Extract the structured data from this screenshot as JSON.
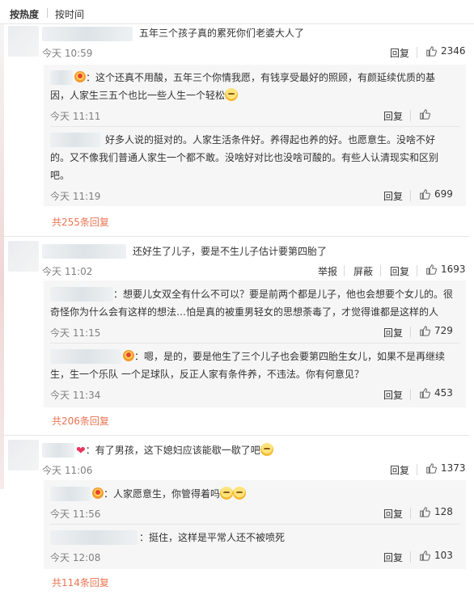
{
  "tabs": {
    "hot": "按热度",
    "time": "按时间"
  },
  "comments": [
    {
      "text": "五年三个孩子真的累死你们老婆大人了",
      "time": "今天 10:59",
      "reply": "回复",
      "likes": "2346",
      "replies": [
        {
          "text_line1": "：这个还真不用酸，五年三个你情我愿，有钱享受最好的照顾，有颜延续优质的基",
          "text_line2": "因，人家生三五个也比一些人生一个轻松",
          "time": "今天 11:11",
          "reply": "回复"
        },
        {
          "text_line1": "好多人说的挺对的。人家生活条件好。养得起也养的好。也愿意生。没啥不好",
          "text_line2": "的。又不像我们普通人家生一个都不敢。没啥好对比也没啥可酸的。有些人认清现实和区别",
          "text_line3": "吧。",
          "time": "今天 11:19",
          "reply": "回复",
          "likes": "699"
        }
      ],
      "more": "共255条回复"
    },
    {
      "text": "还好生了儿子，要是不生儿子估计要第四胎了",
      "time": "今天 11:02",
      "report": "举报",
      "block": "屏蔽",
      "reply": "回复",
      "likes": "1693",
      "replies": [
        {
          "text_line1": "：想要儿女双全有什么不可以？要是前两个都是儿子，他也会想要个女儿的。很",
          "text_line2": "奇怪你为什么会有这样的想法…怕是真的被重男轻女的思想荼毒了，才觉得谁都是这样的人",
          "time": "今天 11:15",
          "reply": "回复",
          "likes": "729"
        },
        {
          "text_line1": "：嗯，是的，要是他生了三个儿子也会要第四胎生女儿，如果不是再继续",
          "text_line2": "生，生一个乐队 一个足球队，反正人家有条件养，不违法。你有何意见？",
          "time": "今天 11:34",
          "reply": "回复",
          "likes": "453"
        }
      ],
      "more": "共206条回复"
    },
    {
      "text": "：有了男孩，这下媳妇应该能歇一歇了吧",
      "time": "今天 11:06",
      "reply": "回复",
      "likes": "1373",
      "replies": [
        {
          "text_line1": "：人家愿意生，你管得着吗",
          "time": "今天 11:56",
          "reply": "回复",
          "likes": "128"
        },
        {
          "text_line1": "：挺住，这样是平常人还不被喷死",
          "time": "今天 12:08",
          "reply": "回复",
          "likes": "103"
        }
      ],
      "more": "共114条回复"
    }
  ],
  "icons": {
    "like": "thumbs-up-icon",
    "badge": "vip-badge-icon",
    "emoji": "smile-emoji-icon",
    "heart": "heart-icon"
  },
  "colors": {
    "link": "#eb7350",
    "meta": "#808080",
    "reply_bg": "#f6f6f6"
  }
}
